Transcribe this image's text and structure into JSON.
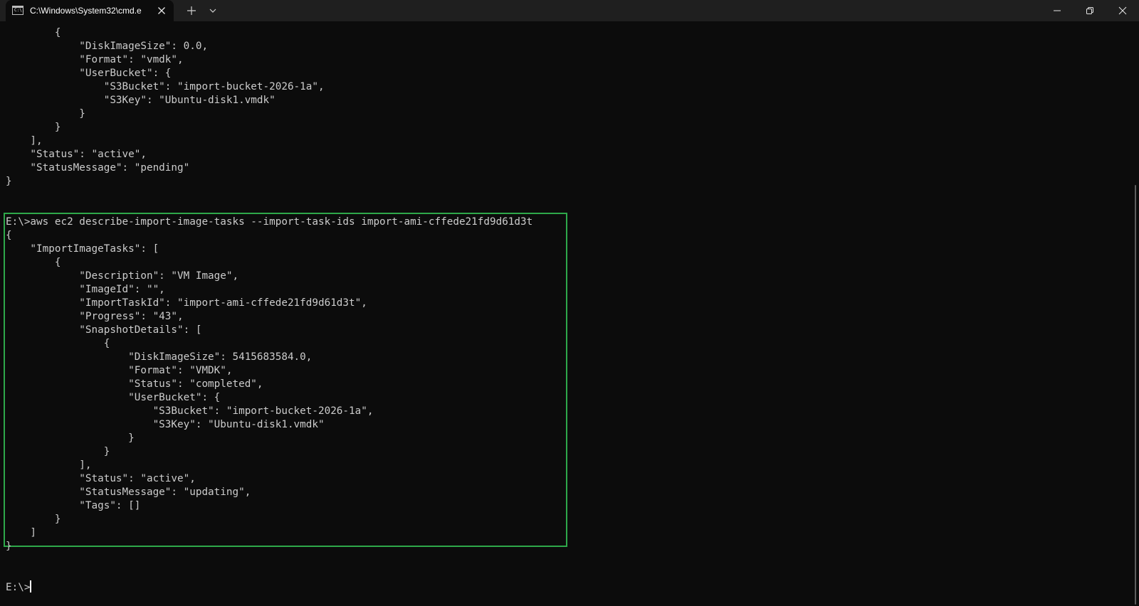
{
  "window": {
    "tab_title": "C:\\Windows\\System32\\cmd.e",
    "tab_icon_text": "C:\\."
  },
  "terminal": {
    "lines": [
      "        {",
      "            \"DiskImageSize\": 0.0,",
      "            \"Format\": \"vmdk\",",
      "            \"UserBucket\": {",
      "                \"S3Bucket\": \"import-bucket-2026-1a\",",
      "                \"S3Key\": \"Ubuntu-disk1.vmdk\"",
      "            }",
      "        }",
      "    ],",
      "    \"Status\": \"active\",",
      "    \"StatusMessage\": \"pending\"",
      "}",
      "",
      "",
      "E:\\>aws ec2 describe-import-image-tasks --import-task-ids import-ami-cffede21fd9d61d3t",
      "{",
      "    \"ImportImageTasks\": [",
      "        {",
      "            \"Description\": \"VM Image\",",
      "            \"ImageId\": \"\",",
      "            \"ImportTaskId\": \"import-ami-cffede21fd9d61d3t\",",
      "            \"Progress\": \"43\",",
      "            \"SnapshotDetails\": [",
      "                {",
      "                    \"DiskImageSize\": 5415683584.0,",
      "                    \"Format\": \"VMDK\",",
      "                    \"Status\": \"completed\",",
      "                    \"UserBucket\": {",
      "                        \"S3Bucket\": \"import-bucket-2026-1a\",",
      "                        \"S3Key\": \"Ubuntu-disk1.vmdk\"",
      "                    }",
      "                }",
      "            ],",
      "            \"Status\": \"active\",",
      "            \"StatusMessage\": \"updating\",",
      "            \"Tags\": []",
      "        }",
      "    ]",
      "}",
      "",
      "",
      "E:\\>"
    ],
    "highlight_color": "#2ea84a",
    "background_color": "#0c0c0c",
    "text_color": "#cccccc"
  }
}
